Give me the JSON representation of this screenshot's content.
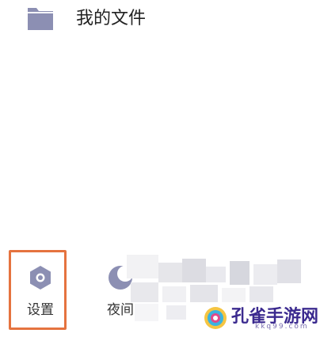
{
  "files_row": {
    "icon": "folder-icon",
    "label": "我的文件"
  },
  "bottom_nav": {
    "settings": {
      "icon": "settings-icon",
      "label": "设置"
    },
    "night_mode": {
      "icon": "moon-icon",
      "label": "夜间"
    }
  },
  "highlight_color": "#e5733f",
  "icon_color": "#8c8fb3",
  "watermark": {
    "text": "孔雀手游网",
    "sub": "kkq99.com"
  }
}
